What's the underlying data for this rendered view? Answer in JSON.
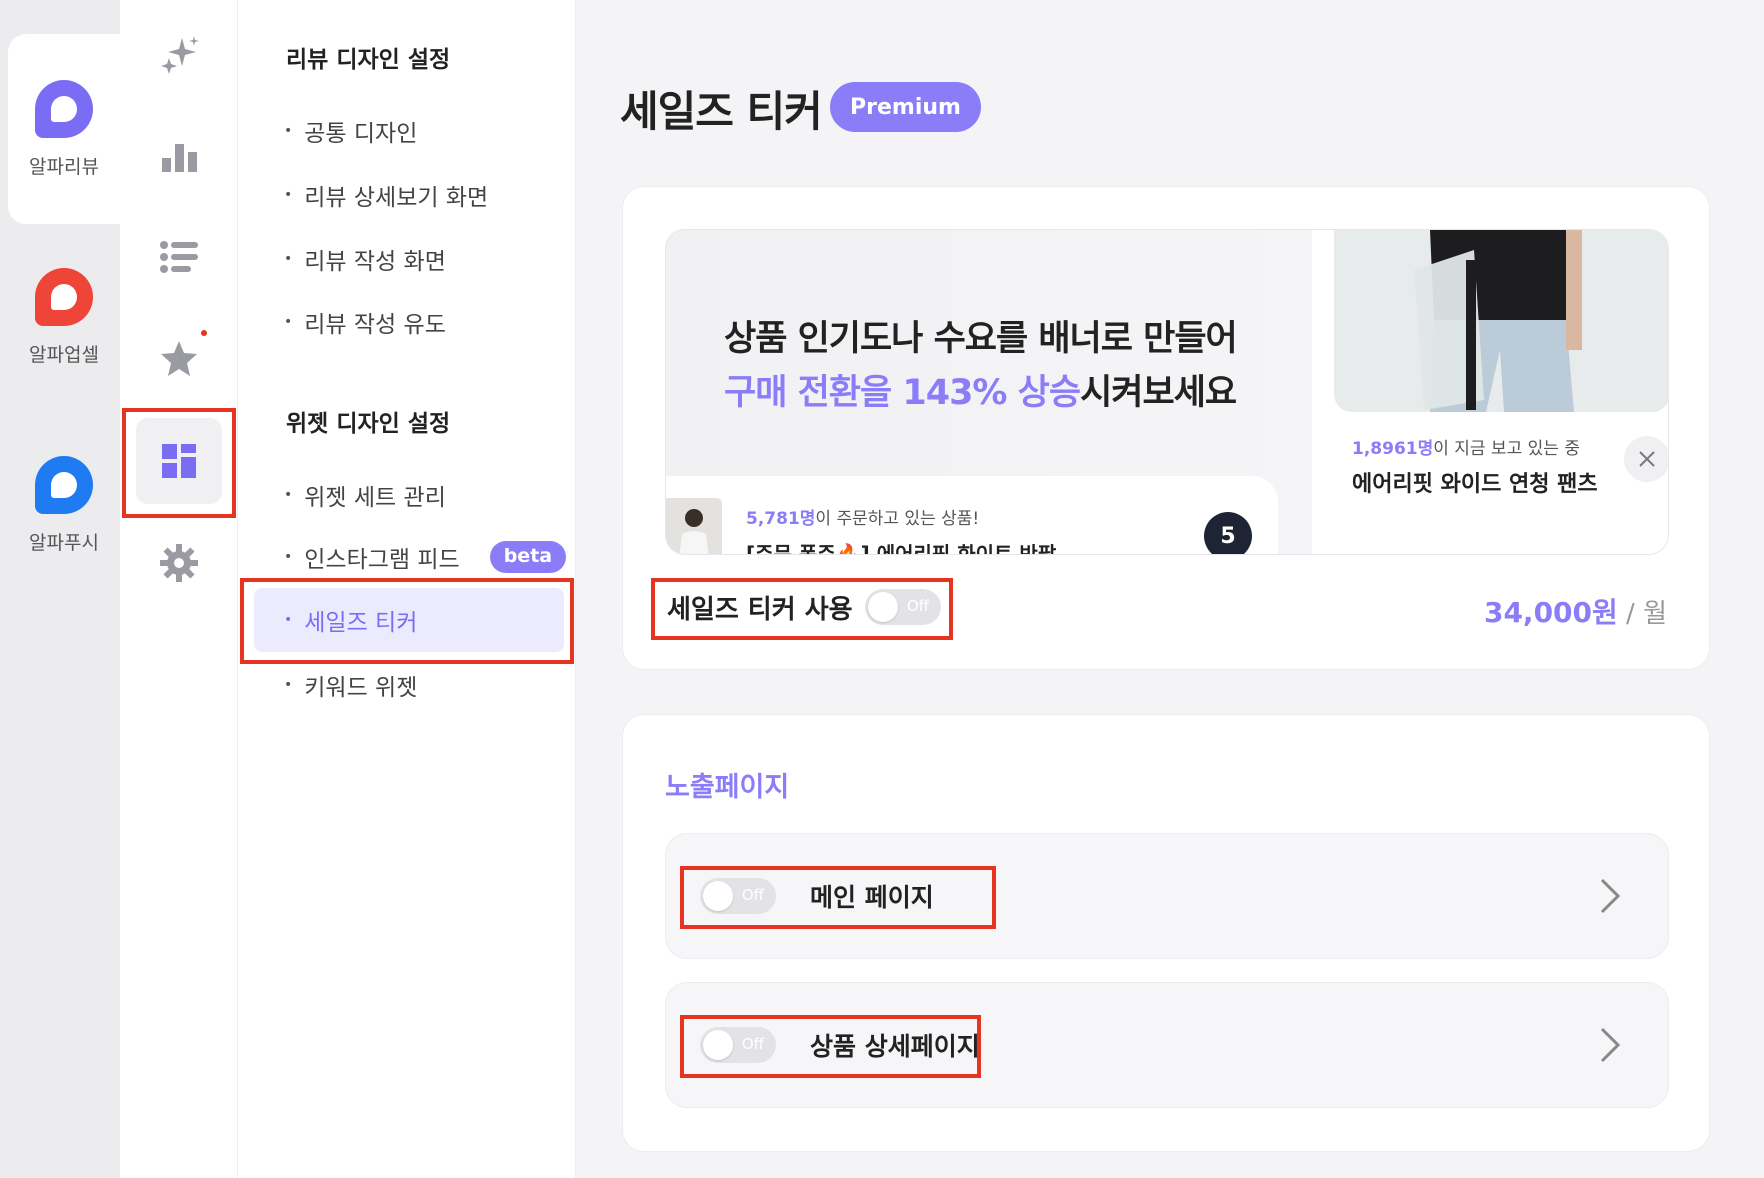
{
  "apps": [
    {
      "label": "알파리뷰",
      "color": "#7b6cf4",
      "active": true
    },
    {
      "label": "알파업셀",
      "color": "#ef4438",
      "active": false
    },
    {
      "label": "알파푸시",
      "color": "#1f7bf2",
      "active": false
    }
  ],
  "rail_icons": [
    "sparkles-icon",
    "bar-chart-icon",
    "list-icon",
    "star-icon",
    "widget-grid-icon",
    "gear-icon"
  ],
  "submenu": {
    "review_design_heading": "리뷰 디자인 설정",
    "review_items": [
      "공통 디자인",
      "리뷰 상세보기 화면",
      "리뷰 작성 화면",
      "리뷰 작성 유도"
    ],
    "widget_design_heading": "위젯 디자인 설정",
    "widget_items": [
      "위젯 세트 관리",
      "인스타그램 피드",
      "세일즈 티커",
      "키워드 위젯"
    ],
    "beta_label": "beta",
    "bullet": "•"
  },
  "page": {
    "title": "세일즈 티커",
    "badge": "Premium"
  },
  "preview": {
    "headline_line1": "상품 인기도나 수요를 배너로 만들어",
    "headline_line2_highlight": "구매 전환을 143% 상승",
    "headline_line2_rest": "시켜보세요",
    "viewer_count": "1,8961명",
    "viewer_suffix": "이 지금 보고 있는 중",
    "product_name": "에어리핏 와이드 연청 팬츠",
    "ticker_count": "5,781명",
    "ticker_suffix": "이 주문하고 있는 상품!",
    "ticker_product": "[주문 폭주🔥] 에어리핏 화이트 반팔",
    "ticker_badge": "5"
  },
  "usage": {
    "label": "세일즈 티커 사용",
    "toggle": "Off",
    "price_amount": "34,000원",
    "price_unit": " / 월"
  },
  "exposure": {
    "title": "노출페이지",
    "rows": [
      {
        "label": "메인 페이지",
        "toggle": "Off"
      },
      {
        "label": "상품 상세페이지",
        "toggle": "Off"
      }
    ]
  },
  "colors": {
    "accent": "#8b7cf8",
    "highlight_box": "#e5341f"
  }
}
